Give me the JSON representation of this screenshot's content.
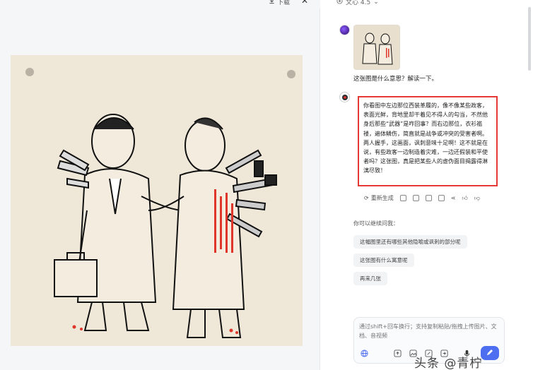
{
  "viewer": {
    "download_label": "下载",
    "close_icon": "close-icon"
  },
  "model": {
    "name": "文心 4.5"
  },
  "chat": {
    "user_question": "这张图是什么意思？解读一下。",
    "answer": "你看图中左边那位西装革履的，像不像某些政客，表面光鲜，背地里却干着见不得人的勾当，不然他身后那些“武器”是咋回事？而右边那位，衣衫褴褛，遍体鳞伤，简直就是战争或冲突的受害者啊。两人握手，这画面，讽刺意味十足啊！这不就是在说，有些政客一边制造着灾难，一边还假装和平使者吗？这张图，真是把某些人的虚伪面目揭露得淋漓尽致！",
    "regenerate_label": "重新生成",
    "suggest_title": "你可以继续问我：",
    "suggestions": [
      "这幅图里还有哪些其他隐喻或讽刺的部分呢",
      "这张图有什么寓意呢",
      "再来几张"
    ],
    "input_placeholder": "通过shift+回车换行；支持复制粘贴/拖拽上传图片、文档、音视频"
  },
  "watermark": "头条 @青柠",
  "colors": {
    "accent": "#4e6ef2",
    "highlight_border": "#e53935"
  }
}
